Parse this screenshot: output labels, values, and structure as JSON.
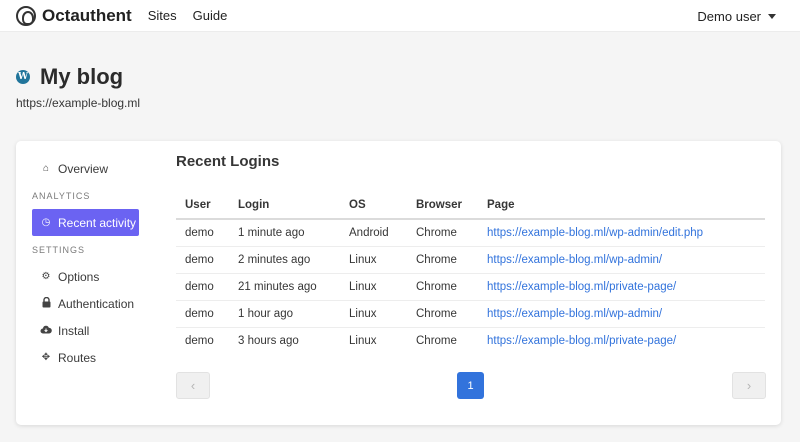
{
  "navbar": {
    "brand": "Octauthent",
    "links": [
      "Sites",
      "Guide"
    ],
    "user_menu": "Demo user"
  },
  "header": {
    "title": "My blog",
    "url": "https://example-blog.ml"
  },
  "sidebar": {
    "overview": "Overview",
    "analytics_label": "ANALYTICS",
    "recent_activity": "Recent activity",
    "settings_label": "SETTINGS",
    "options": "Options",
    "authentication": "Authentication",
    "install": "Install",
    "routes": "Routes"
  },
  "main": {
    "title": "Recent Logins",
    "columns": [
      "User",
      "Login",
      "OS",
      "Browser",
      "Page"
    ],
    "rows": [
      [
        "demo",
        "1 minute ago",
        "Android",
        "Chrome",
        "https://example-blog.ml/wp-admin/edit.php"
      ],
      [
        "demo",
        "2 minutes ago",
        "Linux",
        "Chrome",
        "https://example-blog.ml/wp-admin/"
      ],
      [
        "demo",
        "21 minutes ago",
        "Linux",
        "Chrome",
        "https://example-blog.ml/private-page/"
      ],
      [
        "demo",
        "1 hour ago",
        "Linux",
        "Chrome",
        "https://example-blog.ml/wp-admin/"
      ],
      [
        "demo",
        "3 hours ago",
        "Linux",
        "Chrome",
        "https://example-blog.ml/private-page/"
      ]
    ]
  },
  "pagination": {
    "prev": "‹",
    "current_page": "1",
    "next": "›"
  },
  "colors": {
    "accent": "#6b63f2",
    "link": "#3273dc"
  }
}
